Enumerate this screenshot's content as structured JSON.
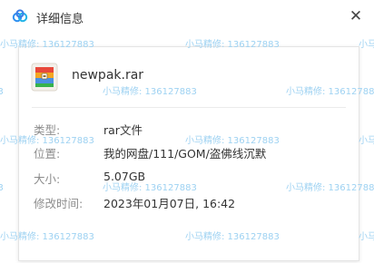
{
  "window": {
    "title": "详细信息",
    "close_glyph": "✕",
    "app_icon": "baidu-netdisk-cloud-icon"
  },
  "file": {
    "name": "newpak.rar",
    "icon": "rar-archive-icon"
  },
  "details": [
    {
      "label": "类型:",
      "value": "rar文件"
    },
    {
      "label": "位置:",
      "value": "我的网盘/111/GOM/盗佛线沉默"
    },
    {
      "label": "大小:",
      "value": "5.07GB"
    },
    {
      "label": "修改时间:",
      "value": "2023年01月07日, 16:42"
    }
  ],
  "watermark": {
    "text": "小马精修: 136127883",
    "color": "#9ed2f2"
  },
  "colors": {
    "label": "#8c8c8c",
    "value": "#333333",
    "card_border": "#e4e4e4"
  }
}
